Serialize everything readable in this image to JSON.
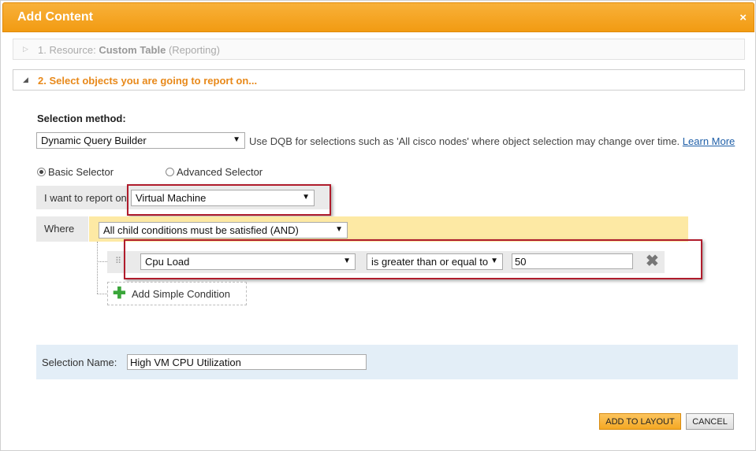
{
  "dialog": {
    "title": "Add Content",
    "close_glyph": "×"
  },
  "steps": [
    {
      "arrow": "▷",
      "label": "1. Resource: ",
      "value": "Custom Table",
      "suffix": " (Reporting)"
    },
    {
      "arrow": "◢",
      "label": "2. Select objects you are going to report on..."
    }
  ],
  "selection_method": {
    "label": "Selection method:",
    "value": "Dynamic Query Builder",
    "hint": "Use DQB for selections such as 'All cisco nodes' where object selection may change over time.",
    "learn_more": "Learn More"
  },
  "selector_modes": {
    "basic": "Basic Selector",
    "advanced": "Advanced Selector",
    "selected": "basic"
  },
  "report_on": {
    "label": "I want to report on",
    "value": "Virtual Machine"
  },
  "where": {
    "label": "Where",
    "logic_value": "All child conditions must be satisfied (AND)"
  },
  "condition": {
    "field": "Cpu Load",
    "operator": "is greater than or equal to",
    "value": "50"
  },
  "add_condition": {
    "label": "Add Simple Condition"
  },
  "selection_name": {
    "label": "Selection Name:",
    "value": "High VM CPU Utilization"
  },
  "buttons": {
    "add": "ADD TO LAYOUT",
    "cancel": "CANCEL"
  },
  "icons": {
    "caret": "▼",
    "grip": "⠿",
    "delete": "✖",
    "plus": "✚"
  },
  "colors": {
    "title_bar": "#f29b12",
    "step_active": "#e8891a",
    "and_bar": "#fde9a4",
    "name_bar": "#e3eef7",
    "highlight": "#b01c2c"
  }
}
